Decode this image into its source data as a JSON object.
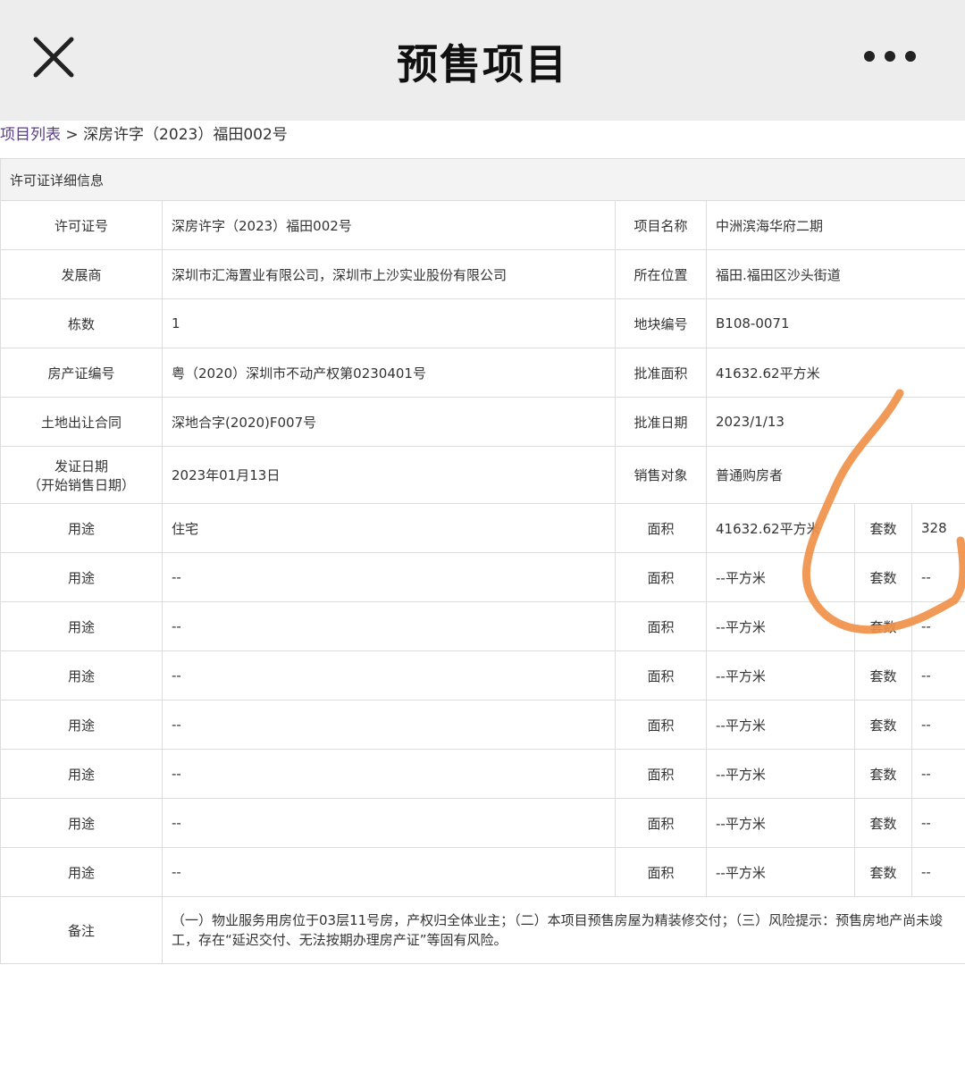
{
  "header": {
    "title": "预售项目",
    "close_icon": "close-icon",
    "more_icon": "more-horizontal-icon"
  },
  "breadcrumb": {
    "link": "项目列表",
    "separator": ">",
    "current": "深房许字（2023）福田002号"
  },
  "section_title": "许可证详细信息",
  "info": {
    "permit_no_label": "许可证号",
    "permit_no": "深房许字（2023）福田002号",
    "project_name_label": "项目名称",
    "project_name": "中洲滨海华府二期",
    "developer_label": "发展商",
    "developer": "深圳市汇海置业有限公司，深圳市上沙实业股份有限公司",
    "location_label": "所在位置",
    "location": "福田.福田区沙头街道",
    "buildings_label": "栋数",
    "buildings": "1",
    "plot_no_label": "地块编号",
    "plot_no": "B108-0071",
    "property_cert_label": "房产证编号",
    "property_cert": "粤（2020）深圳市不动产权第0230401号",
    "approved_area_label": "批准面积",
    "approved_area": "41632.62平方米",
    "land_contract_label": "土地出让合同",
    "land_contract": "深地合字(2020)F007号",
    "approved_date_label": "批准日期",
    "approved_date": "2023/1/13",
    "issue_date_label_1": "发证日期",
    "issue_date_label_2": "（开始销售日期）",
    "issue_date": "2023年01月13日",
    "sales_target_label": "销售对象",
    "sales_target": "普通购房者"
  },
  "usage_labels": {
    "usage": "用途",
    "area": "面积",
    "units": "套数"
  },
  "usage_rows": [
    {
      "usage": "住宅",
      "area": "41632.62平方米",
      "units": "328"
    },
    {
      "usage": "--",
      "area": "--平方米",
      "units": "--"
    },
    {
      "usage": "--",
      "area": "--平方米",
      "units": "--"
    },
    {
      "usage": "--",
      "area": "--平方米",
      "units": "--"
    },
    {
      "usage": "--",
      "area": "--平方米",
      "units": "--"
    },
    {
      "usage": "--",
      "area": "--平方米",
      "units": "--"
    },
    {
      "usage": "--",
      "area": "--平方米",
      "units": "--"
    },
    {
      "usage": "--",
      "area": "--平方米",
      "units": "--"
    }
  ],
  "remarks": {
    "label": "备注",
    "text": "（一）物业服务用房位于03层11号房，产权归全体业主；（二）本项目预售房屋为精装修交付；（三）风险提示：预售房地产尚未竣工，存在“延迟交付、无法按期办理房产证”等固有风险。"
  },
  "colors": {
    "header_bg": "#ededed",
    "link": "#5a3d8a",
    "border": "#dcdcdc",
    "scribble": "#f0914a"
  }
}
